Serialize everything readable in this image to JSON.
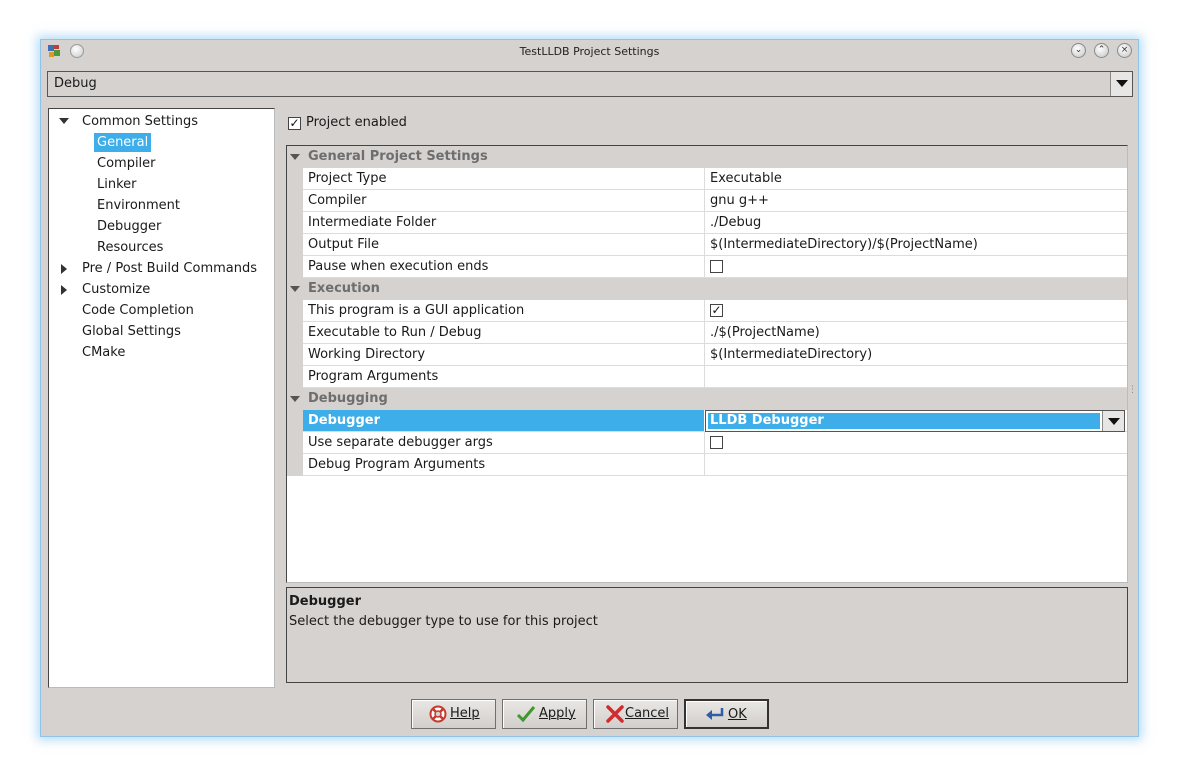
{
  "window": {
    "title": "TestLLDB Project Settings",
    "controls": [
      "minimize-icon",
      "maximize-icon",
      "close-icon"
    ]
  },
  "configuration": {
    "selected": "Debug"
  },
  "tree": {
    "common_settings": "Common Settings",
    "children": [
      "General",
      "Compiler",
      "Linker",
      "Environment",
      "Debugger",
      "Resources"
    ],
    "selected": "General",
    "others": [
      "Pre / Post Build Commands",
      "Customize",
      "Code Completion",
      "Global Settings",
      "CMake"
    ]
  },
  "project_enabled": {
    "label": "Project enabled",
    "checked": true
  },
  "grid": {
    "general": {
      "title": "General Project Settings",
      "rows": [
        {
          "name": "Project Type",
          "value": "Executable"
        },
        {
          "name": "Compiler",
          "value": "gnu g++"
        },
        {
          "name": "Intermediate Folder",
          "value": "./Debug"
        },
        {
          "name": "Output File",
          "value": "$(IntermediateDirectory)/$(ProjectName)"
        },
        {
          "name": "Pause when execution ends",
          "checked": false
        }
      ]
    },
    "execution": {
      "title": "Execution",
      "rows": [
        {
          "name": "This program is a GUI application",
          "checked": true
        },
        {
          "name": "Executable to Run / Debug",
          "value": "./$(ProjectName)"
        },
        {
          "name": "Working Directory",
          "value": "$(IntermediateDirectory)"
        },
        {
          "name": "Program Arguments",
          "value": ""
        }
      ]
    },
    "debugging": {
      "title": "Debugging",
      "rows": [
        {
          "name": "Debugger",
          "value": "LLDB Debugger"
        },
        {
          "name": "Use separate debugger args",
          "checked": false
        },
        {
          "name": "Debug Program Arguments",
          "value": ""
        }
      ]
    }
  },
  "description": {
    "title": "Debugger",
    "text": "Select the debugger type to use for this project"
  },
  "buttons": {
    "help": "Help",
    "apply": "Apply",
    "cancel": "Cancel",
    "ok": "OK"
  },
  "colors": {
    "selection": "#3daee9",
    "window_bg": "#d6d2d0",
    "glow": "#8fc4e8"
  }
}
